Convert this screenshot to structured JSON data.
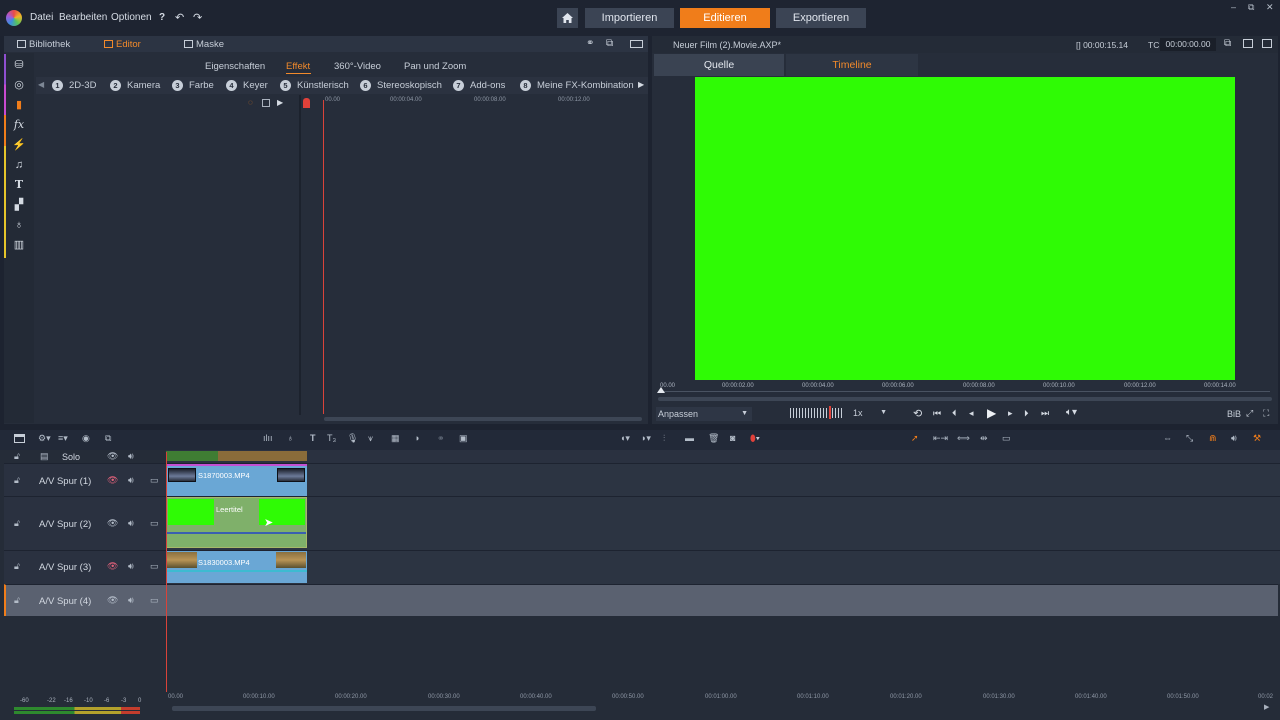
{
  "menu": {
    "file": "Datei",
    "edit": "Bearbeiten",
    "options": "Optionen",
    "help": "?"
  },
  "topbar": {
    "import": "Importieren",
    "edit": "Editieren",
    "export": "Exportieren"
  },
  "left_tabs": {
    "library": "Bibliothek",
    "editor": "Editor",
    "mask": "Maske"
  },
  "sub_tabs": {
    "properties": "Eigenschaften",
    "effect": "Effekt",
    "vr": "360°-Video",
    "panzoom": "Pan und Zoom"
  },
  "categories": [
    {
      "num": "1",
      "label": "2D-3D"
    },
    {
      "num": "2",
      "label": "Kamera"
    },
    {
      "num": "3",
      "label": "Farbe"
    },
    {
      "num": "4",
      "label": "Keyer"
    },
    {
      "num": "5",
      "label": "Künstlerisch"
    },
    {
      "num": "6",
      "label": "Stereoskopisch"
    },
    {
      "num": "7",
      "label": "Add-ons"
    },
    {
      "num": "8",
      "label": "Meine FX-Kombinatione"
    }
  ],
  "effect_ruler": [
    "00.00",
    "00:00:04.00",
    "00:00:08.00",
    "00:00:12.00"
  ],
  "preview": {
    "title": "Neuer Film (2).Movie.AXP*",
    "duration": "[] 00:00:15.14",
    "tc_label": "TC",
    "tc_value": "00:00:00.00",
    "source_tab": "Quelle",
    "timeline_tab": "Timeline",
    "ruler": [
      "00.00",
      "00:00:02.00",
      "00:00:04.00",
      "00:00:06.00",
      "00:00:08.00",
      "00:00:10.00",
      "00:00:12.00",
      "00:00:14.00"
    ],
    "fit": "Anpassen",
    "speed": "1x",
    "pip": "BiB",
    "color": "#2ffb05"
  },
  "tracks": {
    "solo": "Solo",
    "names": [
      "A/V Spur (1)",
      "A/V Spur (2)",
      "A/V Spur (3)",
      "A/V Spur (4)"
    ],
    "clips": {
      "clip1": "S1870003.MP4",
      "clip2": "Leertitel",
      "clip3": "S1830003.MP4"
    }
  },
  "bottom_ruler": [
    "00.00",
    "00:00:10.00",
    "00:00:20.00",
    "00:00:30.00",
    "00:00:40.00",
    "00:00:50.00",
    "00:01:00.00",
    "00:01:10.00",
    "00:01:20.00",
    "00:01:30.00",
    "00:01:40.00",
    "00:01:50.00",
    "00:02"
  ],
  "meter_labels": [
    "-60",
    "-22",
    "-16",
    "-10",
    "-6",
    "-3",
    "0"
  ],
  "accent": "#f07d1a"
}
